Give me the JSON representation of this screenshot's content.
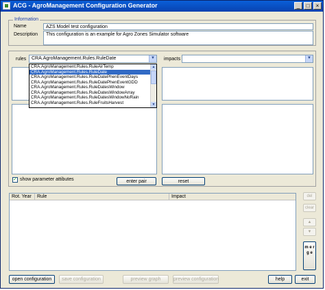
{
  "window": {
    "title": "ACG - AgroManagement Configuration Generator",
    "min": "_",
    "max": "□",
    "close": "×"
  },
  "information": {
    "legend": "Information",
    "name_label": "Name",
    "name_value": "AZS Model test configuration",
    "description_label": "Description",
    "description_value": "This configuration is an example for Agro Zones Simulator software"
  },
  "rules": {
    "label": "rules",
    "selected": "CRA.AgroManagement.Rules.RuleDate",
    "options": [
      "CRA.AgroManagement.Rules.RuleAirTemp",
      "CRA.AgroManagement.Rules.RuleDate",
      "CRA.AgroManagement.Rules.RuleDatePhenEventDays",
      "CRA.AgroManagement.Rules.RuleDatePhenEventGDD",
      "CRA.AgroManagement.Rules.RuleDatesWindow",
      "CRA.AgroManagement.Rules.RuleDatesWindowArray",
      "CRA.AgroManagement.Rules.RuleDatesWindowNoRain",
      "CRA.AgroManagement.Rules.RuleFruitsHarvest"
    ]
  },
  "impacts": {
    "label": "impacts",
    "selected": ""
  },
  "show_params": {
    "label": "show parameter attibutes",
    "checked": true
  },
  "pair_buttons": {
    "enter": "enter pair",
    "reset": "reset"
  },
  "table": {
    "columns": [
      "Rot. Year",
      "Rule",
      "Impact"
    ]
  },
  "side_buttons": {
    "del": "del",
    "clear": "clear",
    "up": "▲",
    "down": "▼",
    "merge": "m e r g e"
  },
  "bottom_buttons": {
    "open": "open configuration",
    "save": "save configuration",
    "preview_graph": "preview graph",
    "preview_conf": "preview configuration",
    "help": "help",
    "exit": "exit"
  },
  "colors": {
    "title_bar": "#0842b0",
    "selection": "#316ac5",
    "legend": "#1c3ea8"
  }
}
